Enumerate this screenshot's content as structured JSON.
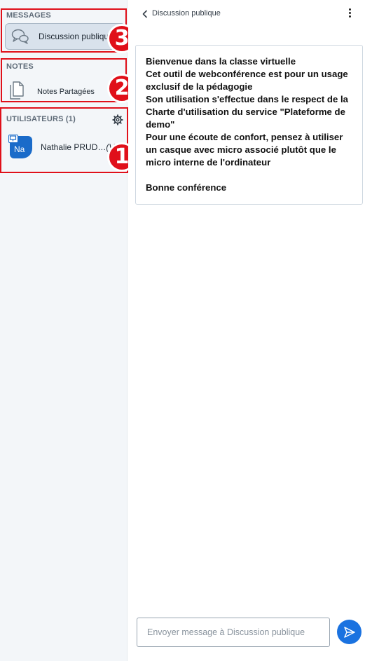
{
  "sidebar": {
    "messages": {
      "title": "MESSAGES",
      "public_chat_label": "Discussion publique"
    },
    "notes": {
      "title": "NOTES",
      "shared_notes_label": "Notes Partagées"
    },
    "users": {
      "title": "UTILISATEURS (1)",
      "list": [
        {
          "initials": "Na",
          "name": "Nathalie PRUD…",
          "suffix": "(Vous)"
        }
      ]
    }
  },
  "annotations": {
    "badge_1": "1",
    "badge_2": "2",
    "badge_3": "3"
  },
  "chat": {
    "title": "Discussion publique",
    "welcome_lines": [
      "Bienvenue dans la classe virtuelle",
      "Cet outil de webconférence est pour un usage exclusif de la pédagogie",
      "Son utilisation s'effectue dans le respect de la Charte d'utilisation du service \"Plateforme de demo\"",
      "Pour une écoute de confort, pensez à utiliser un casque avec micro associé plutôt que le micro interne de l'ordinateur",
      "Bonne conférence"
    ],
    "input_placeholder": "Envoyer message à Discussion publique"
  },
  "colors": {
    "accent": "#1a72e0",
    "annotation_red": "#e0101a",
    "sidebar_bg": "#f3f6f9",
    "avatar": "#1a6bc9"
  },
  "icons": [
    "chat-bubbles-icon",
    "notes-document-icon",
    "gear-icon",
    "presenter-icon",
    "back-chevron-icon",
    "more-options-icon",
    "send-icon"
  ]
}
